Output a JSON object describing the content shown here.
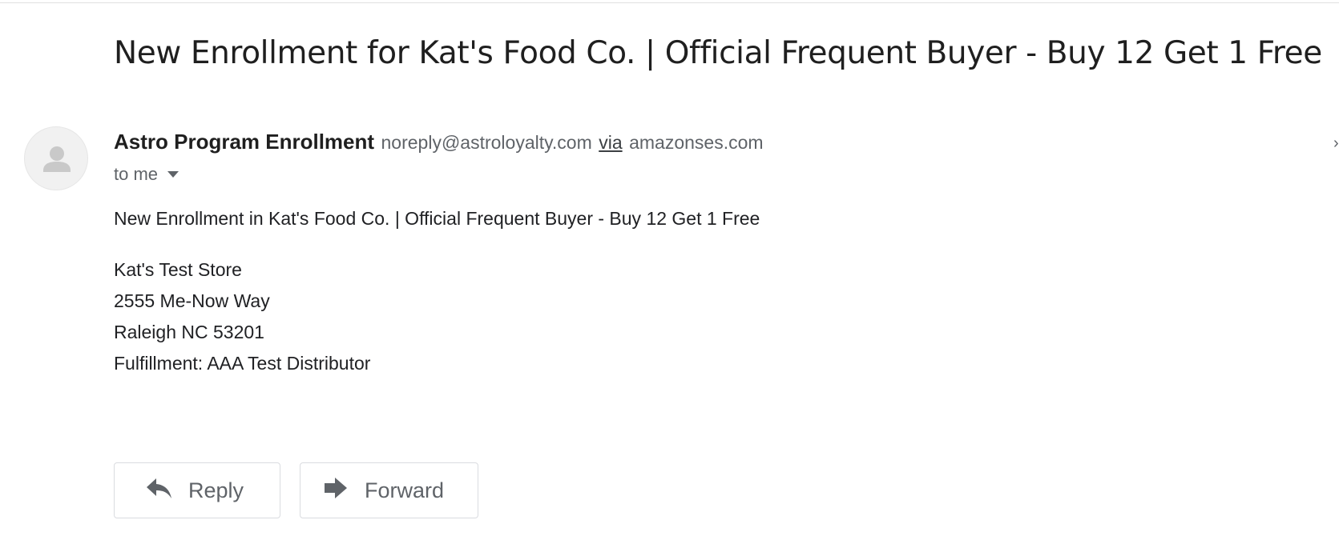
{
  "email": {
    "subject": "New Enrollment for Kat's Food Co. | Official Frequent Buyer - Buy 12 Get 1 Free",
    "sender": {
      "name": "Astro Program Enrollment",
      "email": "noreply@astroloyalty.com",
      "via_label": "via",
      "via_domain": "amazonses.com",
      "avatar_icon": "person-icon"
    },
    "recipient_label": "to me",
    "body": {
      "headline": "New Enrollment in Kat's Food Co. | Official Frequent Buyer - Buy 12 Get 1 Free",
      "store_name": "Kat's Test Store",
      "address_line1": "2555 Me-Now Way",
      "address_line2": "Raleigh NC 53201",
      "fulfillment": "Fulfillment: AAA Test Distributor"
    }
  },
  "actions": {
    "reply_label": "Reply",
    "reply_icon": "reply-arrow-icon",
    "forward_label": "Forward",
    "forward_icon": "forward-arrow-icon"
  },
  "colors": {
    "text_primary": "#202124",
    "text_secondary": "#5f6368",
    "border": "#dadce0",
    "avatar_bg": "#f1f1f1"
  }
}
